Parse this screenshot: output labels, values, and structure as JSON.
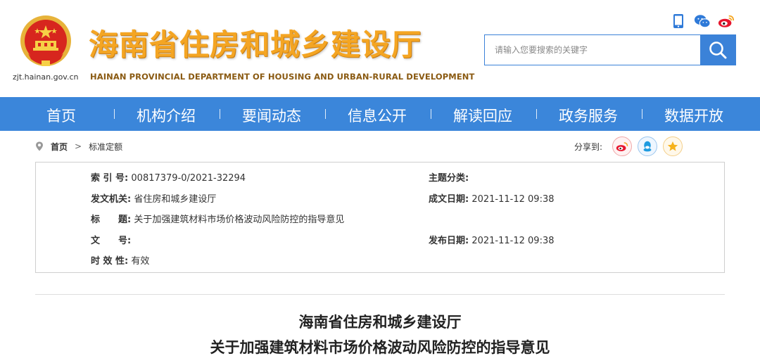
{
  "header": {
    "domain": "zjt.hainan.gov.cn",
    "title": "海南省住房和城乡建设厅",
    "subtitle": "HAINAN PROVINCIAL DEPARTMENT OF HOUSING AND URBAN-RURAL DEVELOPMENT",
    "icons": [
      "mobile-icon",
      "wechat-icon",
      "weibo-icon"
    ]
  },
  "search": {
    "placeholder": "请输入您要搜索的关键字",
    "value": ""
  },
  "nav": {
    "items": [
      "首页",
      "机构介绍",
      "要闻动态",
      "信息公开",
      "解读回应",
      "政务服务",
      "数据开放"
    ]
  },
  "breadcrumb": {
    "home": "首页",
    "separator": ">",
    "current": "标准定额"
  },
  "share": {
    "label": "分享到:",
    "icons": [
      "weibo-icon",
      "qq-icon",
      "qzone-icon"
    ]
  },
  "info": {
    "index_label": "索 引 号:",
    "index_value": "00817379-0/2021-32294",
    "topic_label": "主题分类:",
    "topic_value": "",
    "issuer_label": "发文机关:",
    "issuer_value": "省住房和城乡建设厅",
    "created_label": "成文日期:",
    "created_value": "2021-11-12 09:38",
    "title_label": "标　　题:",
    "title_value": "关于加强建筑材料市场价格波动风险防控的指导意见",
    "docno_label": "文　　号:",
    "docno_value": "",
    "published_label": "发布日期:",
    "published_value": "2021-11-12 09:38",
    "validity_label": "时 效 性:",
    "validity_value": "有效"
  },
  "document": {
    "heading_line1": "海南省住房和城乡建设厅",
    "heading_line2": "关于加强建筑材料市场价格波动风险防控的指导意见"
  },
  "colors": {
    "nav_blue": "#3b86da",
    "title_gold": "#f4a523",
    "emblem_red": "#d7261e"
  }
}
